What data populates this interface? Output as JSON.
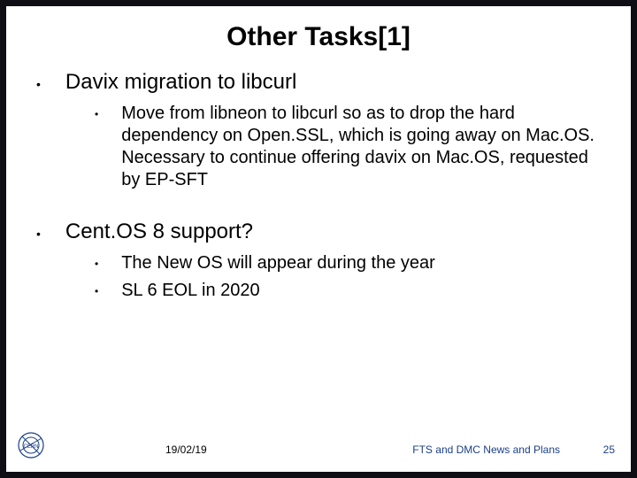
{
  "title": "Other  Tasks[1]",
  "bullets": [
    {
      "text": "Davix migration to libcurl",
      "sub": [
        "Move from libneon to libcurl so as to drop the hard dependency on Open.SSL, which is going away on Mac.OS. Necessary to continue offering davix on Mac.OS, requested by EP-SFT"
      ]
    },
    {
      "text": "Cent.OS 8 support?",
      "sub": [
        "The New OS will appear during the year",
        "SL 6 EOL in 2020"
      ]
    }
  ],
  "footer": {
    "date": "19/02/19",
    "subject": "FTS  and DMC News and Plans",
    "page": "25",
    "logo_label": "CERN"
  }
}
